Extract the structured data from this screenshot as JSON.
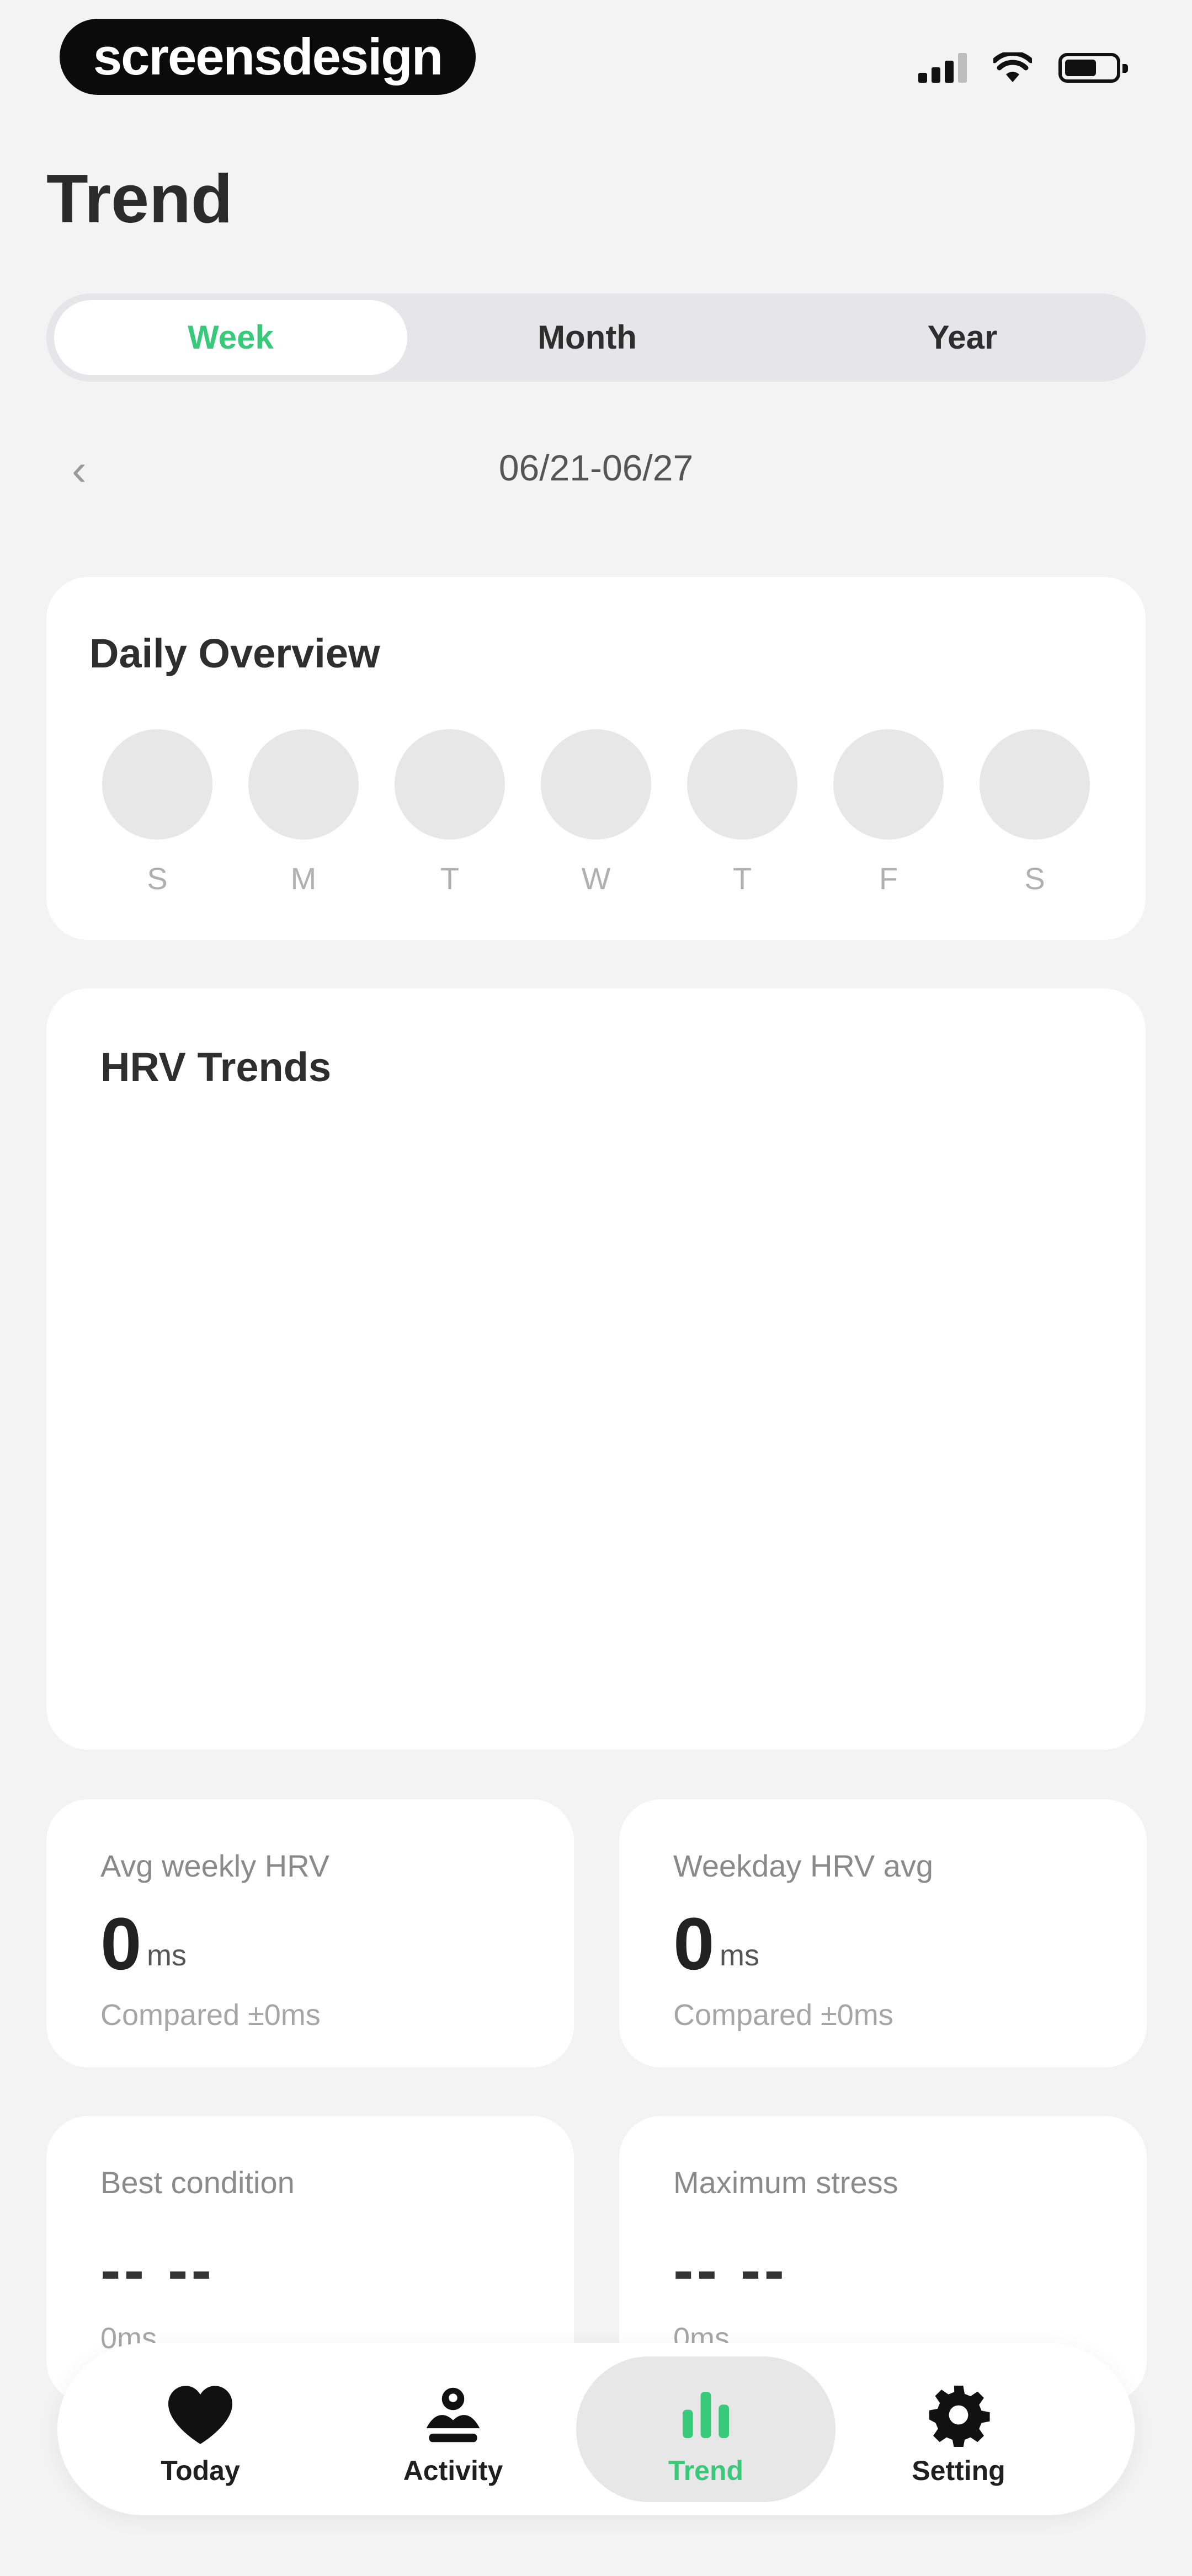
{
  "status_bar": {
    "brand": "screensdesign"
  },
  "header": {
    "title": "Trend"
  },
  "period_tabs": [
    {
      "label": "Week",
      "active": true
    },
    {
      "label": "Month",
      "active": false
    },
    {
      "label": "Year",
      "active": false
    }
  ],
  "date_nav": {
    "prev_icon": "chevron-left-icon",
    "range": "06/21-06/27"
  },
  "daily_overview": {
    "title": "Daily Overview",
    "days": [
      "S",
      "M",
      "T",
      "W",
      "T",
      "F",
      "S"
    ]
  },
  "hrv_trends": {
    "title": "HRV Trends"
  },
  "stats": {
    "avg_weekly": {
      "label": "Avg weekly HRV",
      "value": "0",
      "unit": "ms",
      "compare": "Compared ±0ms"
    },
    "weekday_avg": {
      "label": "Weekday HRV avg",
      "value": "0",
      "unit": "ms",
      "compare": "Compared ±0ms"
    },
    "best_condition": {
      "label": "Best condition",
      "value": "-- --",
      "sub": "0ms"
    },
    "max_stress": {
      "label": "Maximum stress",
      "value": "-- --",
      "sub": "0ms"
    }
  },
  "tab_bar": {
    "items": [
      {
        "label": "Today",
        "icon": "heart-icon",
        "active": false
      },
      {
        "label": "Activity",
        "icon": "activity-icon",
        "active": false
      },
      {
        "label": "Trend",
        "icon": "bar-chart-icon",
        "active": true
      },
      {
        "label": "Setting",
        "icon": "gear-icon",
        "active": false
      }
    ]
  },
  "colors": {
    "accent": "#38c97b",
    "background": "#f3f3f4",
    "card": "#ffffff"
  }
}
